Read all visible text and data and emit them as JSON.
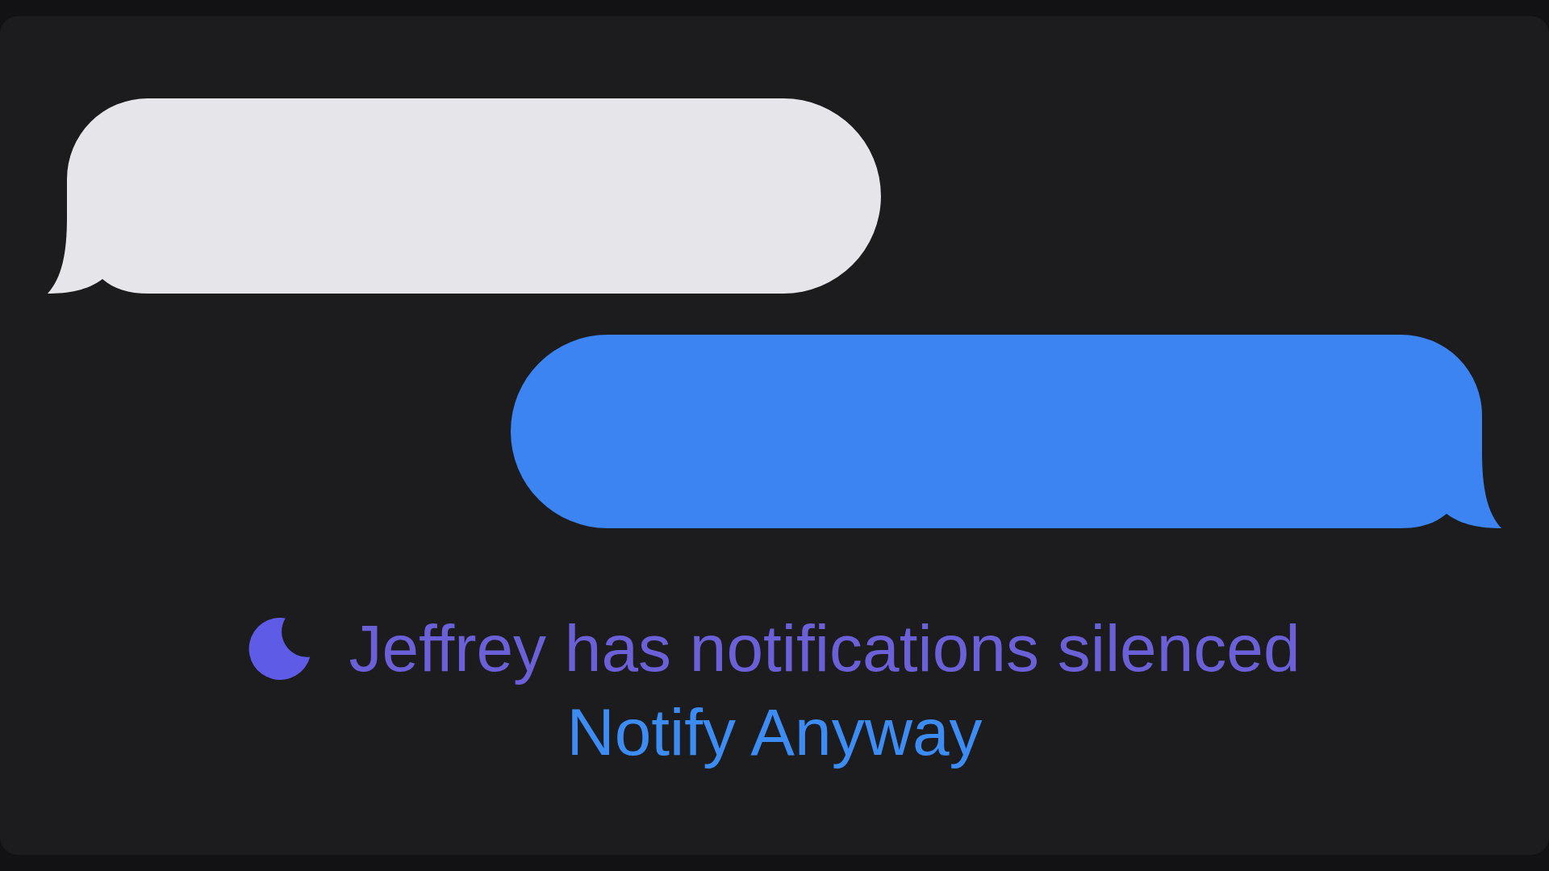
{
  "conversation": {
    "messages": [
      {
        "kind": "received"
      },
      {
        "kind": "sent"
      }
    ]
  },
  "status": {
    "text": "Jeffrey has notifications silenced"
  },
  "action": {
    "label": "Notify Anyway"
  }
}
